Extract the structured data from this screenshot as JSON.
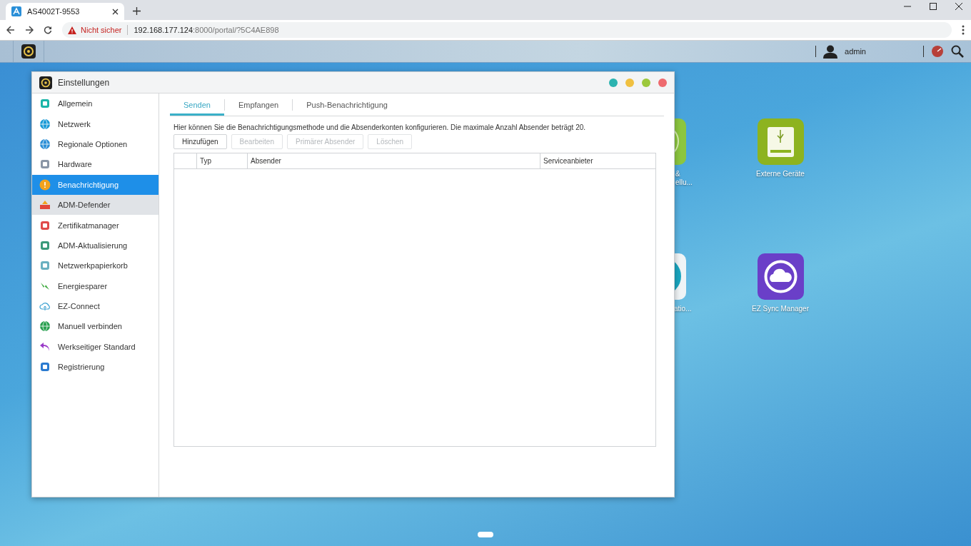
{
  "browser": {
    "tab_title": "AS4002T-9553",
    "security_warning": "Nicht sicher",
    "address_host": "192.168.177.124",
    "address_rest": ":8000/portal/?5C4AE898"
  },
  "taskbar": {
    "user": "admin"
  },
  "desktop_icons": [
    {
      "kind": "partial-green",
      "lines": [
        "&",
        "ellu..."
      ]
    },
    {
      "kind": "partial-teal",
      "lines": [
        "atio..."
      ]
    },
    {
      "kind": "usb-drive",
      "lines": [
        "Externe Geräte"
      ]
    },
    {
      "kind": "sync",
      "lines": [
        "EZ Sync Manager"
      ]
    }
  ],
  "window": {
    "title": "Einstellungen",
    "sidebar": [
      {
        "label": "Allgemein",
        "selected": false,
        "hovered": false
      },
      {
        "label": "Netzwerk",
        "selected": false,
        "hovered": false
      },
      {
        "label": "Regionale Optionen",
        "selected": false,
        "hovered": false
      },
      {
        "label": "Hardware",
        "selected": false,
        "hovered": false
      },
      {
        "label": "Benachrichtigung",
        "selected": true,
        "hovered": false
      },
      {
        "label": "ADM-Defender",
        "selected": false,
        "hovered": true
      },
      {
        "label": "Zertifikatmanager",
        "selected": false,
        "hovered": false
      },
      {
        "label": "ADM-Aktualisierung",
        "selected": false,
        "hovered": false
      },
      {
        "label": "Netzwerkpapierkorb",
        "selected": false,
        "hovered": false
      },
      {
        "label": "Energiesparer",
        "selected": false,
        "hovered": false
      },
      {
        "label": "EZ-Connect",
        "selected": false,
        "hovered": false
      },
      {
        "label": "Manuell verbinden",
        "selected": false,
        "hovered": false
      },
      {
        "label": "Werkseitiger Standard",
        "selected": false,
        "hovered": false
      },
      {
        "label": "Registrierung",
        "selected": false,
        "hovered": false
      }
    ],
    "tabs": [
      {
        "label": "Senden",
        "selected": true
      },
      {
        "label": "Empfangen",
        "selected": false
      },
      {
        "label": "Push-Benachrichtigung",
        "selected": false
      }
    ],
    "description": "Hier können Sie die Benachrichtigungsmethode und die Absenderkonten konfigurieren. Die maximale Anzahl Absender beträgt 20.",
    "buttons": [
      {
        "label": "Hinzufügen",
        "disabled": false
      },
      {
        "label": "Bearbeiten",
        "disabled": true
      },
      {
        "label": "Primärer Absender",
        "disabled": true
      },
      {
        "label": "Löschen",
        "disabled": true
      }
    ],
    "table": {
      "columns": [
        "Typ",
        "Absender",
        "Serviceanbieter"
      ]
    }
  }
}
